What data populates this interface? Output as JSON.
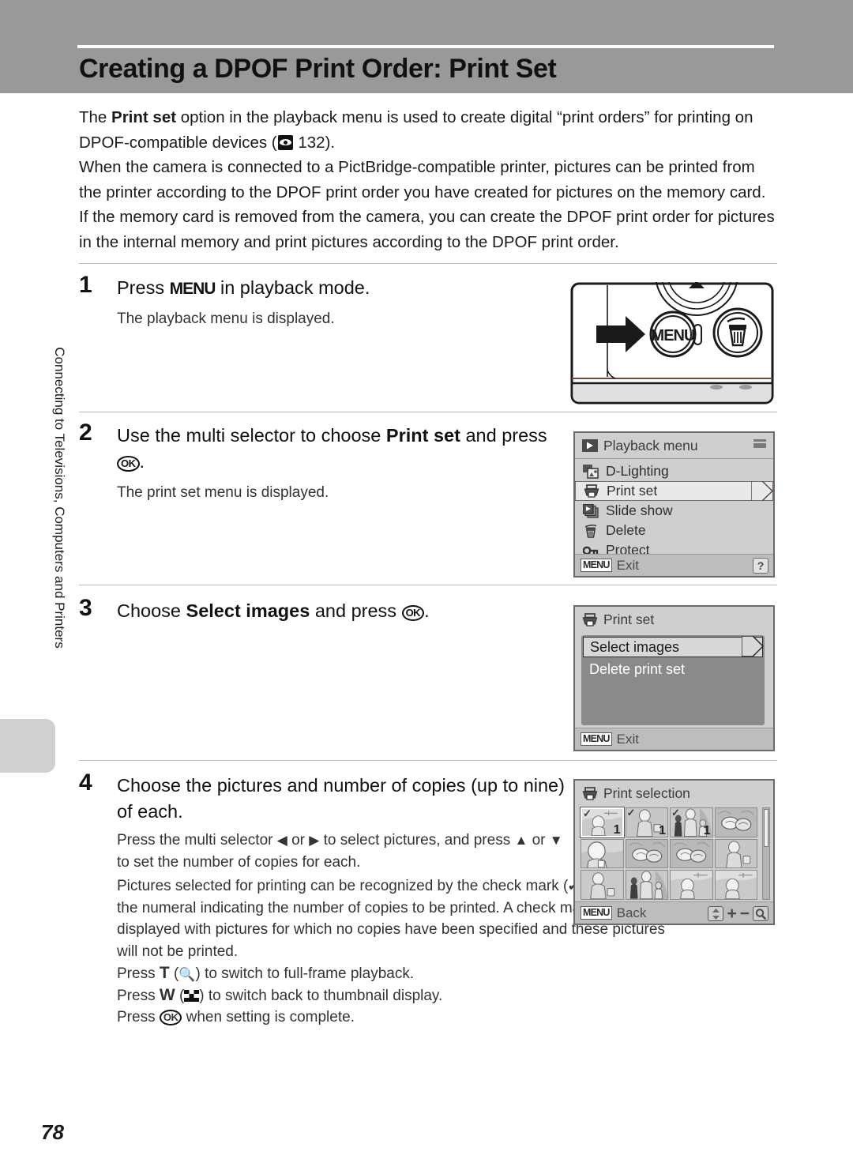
{
  "page": {
    "title": "Creating a DPOF Print Order: Print Set",
    "number": "78",
    "chapter_tab": "Connecting to Televisions, Computers and Printers"
  },
  "intro": {
    "p1_a": "The ",
    "p1_b": "Print set",
    "p1_c": " option in the playback menu is used to create digital “print orders” for printing on DPOF-compatible devices (",
    "p1_ref": "132",
    "p1_d": ").",
    "p2": "When the camera is connected to a PictBridge-compatible printer, pictures can be printed from the printer according to the DPOF print order you have created for pictures on the memory card. If the memory card is removed from the camera, you can create the DPOF print order for pictures in the internal memory and print pictures according to the DPOF print order."
  },
  "steps": [
    {
      "num": "1",
      "head_a": "Press ",
      "head_key": "MENU",
      "head_b": " in playback mode.",
      "body": "The playback menu is displayed."
    },
    {
      "num": "2",
      "head_a": "Use the multi selector to choose ",
      "head_bold": "Print set",
      "head_b": " and press ",
      "head_key": "OK",
      "head_c": ".",
      "body": "The print set menu is displayed."
    },
    {
      "num": "3",
      "head_a": "Choose ",
      "head_bold": "Select images",
      "head_b": " and press ",
      "head_key": "OK",
      "head_c": "."
    },
    {
      "num": "4",
      "head_a": "Choose the pictures and number of copies (up to nine) of each.",
      "body_line1_a": "Press the multi selector ",
      "body_line1_b": " or ",
      "body_line1_c": " to select pictures, and press ",
      "body_line1_d": " or ",
      "body_line1_e": " to set the number of copies for each.",
      "body_p2_a": "Pictures selected for printing can be recognized by the check mark (",
      "body_p2_b": ") icon and the numeral indicating the number of copies to be printed. A check mark is not displayed with pictures for which no copies have been specified and these pictures will not be printed.",
      "body_p3_a": "Press ",
      "body_p3_t": "T",
      "body_p3_b": " (",
      "body_p3_c": ") to switch to full-frame playback.",
      "body_p4_a": "Press ",
      "body_p4_w": "W",
      "body_p4_b": " (",
      "body_p4_c": ") to switch back to thumbnail display.",
      "body_p5_a": "Press ",
      "body_p5_key": "OK",
      "body_p5_b": " when setting is complete."
    }
  ],
  "camera_illustration": {
    "menu_button_label": "MENU",
    "delete_button_icon": "trash-icon",
    "arrow_icon": "arrow-right-icon",
    "indicator_lamp": "led-indicator"
  },
  "lcd_playback_menu": {
    "title": "Playback menu",
    "title_icon": "playback-icon",
    "battery_icon": "battery-icon",
    "items": [
      {
        "label": "D-Lighting",
        "icon": "d-lighting-icon",
        "selected": false
      },
      {
        "label": "Print set",
        "icon": "printer-icon",
        "selected": true
      },
      {
        "label": "Slide show",
        "icon": "slideshow-icon",
        "selected": false
      },
      {
        "label": "Delete",
        "icon": "trash-icon",
        "selected": false
      },
      {
        "label": "Protect",
        "icon": "key-icon",
        "selected": false
      }
    ],
    "footer_tag": "MENU",
    "footer_label": "Exit",
    "help_label": "?"
  },
  "lcd_print_set": {
    "title": "Print set",
    "title_icon": "printer-icon",
    "items": [
      {
        "label": "Select images",
        "selected": true
      },
      {
        "label": "Delete print set",
        "selected": false
      }
    ],
    "footer_tag": "MENU",
    "footer_label": "Exit"
  },
  "lcd_print_selection": {
    "title": "Print selection",
    "title_icon": "printer-icon",
    "footer_tag": "MENU",
    "footer_label": "Back",
    "controls": {
      "updown_icon": "up-down-selector-icon",
      "plus": "+",
      "minus": "−",
      "zoom_icon": "magnifier-icon"
    },
    "thumbnails": [
      {
        "index": 1,
        "scene": "portrait-helicopter",
        "checked": true,
        "copies": "1",
        "current": true
      },
      {
        "index": 2,
        "scene": "woman-with-bag",
        "checked": true,
        "copies": "1",
        "current": false
      },
      {
        "index": 3,
        "scene": "family-group",
        "checked": true,
        "copies": "1",
        "current": false
      },
      {
        "index": 4,
        "scene": "flowers",
        "checked": false,
        "copies": "",
        "current": false
      },
      {
        "index": 5,
        "scene": "portrait-closeup",
        "checked": false,
        "copies": "",
        "current": false
      },
      {
        "index": 6,
        "scene": "flowers",
        "checked": false,
        "copies": "",
        "current": false
      },
      {
        "index": 7,
        "scene": "flowers",
        "checked": false,
        "copies": "",
        "current": false
      },
      {
        "index": 8,
        "scene": "woman-with-bag",
        "checked": false,
        "copies": "",
        "current": false
      },
      {
        "index": 9,
        "scene": "woman-with-bag",
        "checked": false,
        "copies": "",
        "current": false
      },
      {
        "index": 10,
        "scene": "family-group",
        "checked": false,
        "copies": "",
        "current": false
      },
      {
        "index": 11,
        "scene": "portrait-helicopter",
        "checked": false,
        "copies": "",
        "current": false
      },
      {
        "index": 12,
        "scene": "portrait-helicopter",
        "checked": false,
        "copies": "",
        "current": false
      }
    ]
  },
  "colors": {
    "header_band": "#999999",
    "lcd_bg": "#cfcfcf",
    "lcd_border": "#6a6a6a",
    "selected_row": "#e9e9e9",
    "print_set_body": "#8a8a8a"
  }
}
